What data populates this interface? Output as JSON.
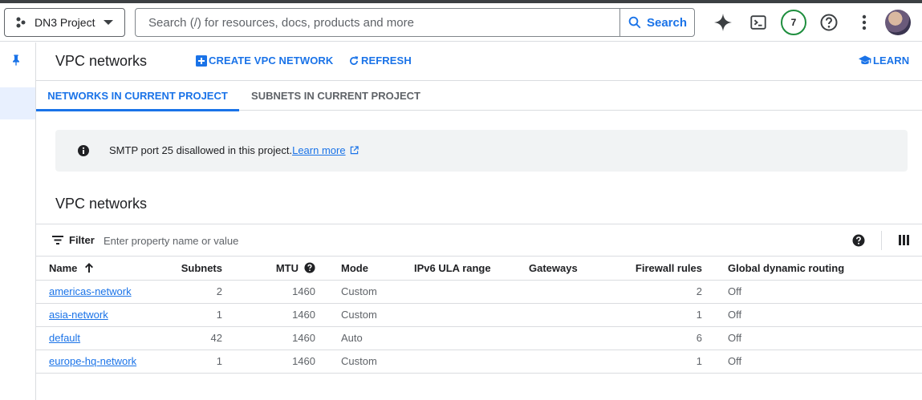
{
  "header": {
    "project": "DN3 Project",
    "search_placeholder": "Search (/) for resources, docs, products and more",
    "search_button": "Search",
    "notification_count": "7",
    "icons": [
      "gemini-sparkle-icon",
      "cloud-shell-icon",
      "help-icon",
      "more-vert-icon"
    ]
  },
  "page": {
    "title": "VPC networks",
    "create_label": "CREATE VPC NETWORK",
    "refresh_label": "REFRESH",
    "learn_label": "LEARN"
  },
  "tabs": [
    {
      "label": "NETWORKS IN CURRENT PROJECT",
      "active": true
    },
    {
      "label": "SUBNETS IN CURRENT PROJECT",
      "active": false
    }
  ],
  "banner": {
    "message": "SMTP port 25 disallowed in this project.",
    "link": "Learn more"
  },
  "section": {
    "title": "VPC networks",
    "filter_label": "Filter",
    "filter_placeholder": "Enter property name or value"
  },
  "table": {
    "columns": [
      "Name",
      "Subnets",
      "MTU",
      "Mode",
      "IPv6 ULA range",
      "Gateways",
      "Firewall rules",
      "Global dynamic routing"
    ],
    "rows": [
      {
        "name": "americas-network",
        "subnets": "2",
        "mtu": "1460",
        "mode": "Custom",
        "ipv6": "",
        "gateways": "",
        "firewall": "2",
        "gdr": "Off"
      },
      {
        "name": "asia-network",
        "subnets": "1",
        "mtu": "1460",
        "mode": "Custom",
        "ipv6": "",
        "gateways": "",
        "firewall": "1",
        "gdr": "Off"
      },
      {
        "name": "default",
        "subnets": "42",
        "mtu": "1460",
        "mode": "Auto",
        "ipv6": "",
        "gateways": "",
        "firewall": "6",
        "gdr": "Off"
      },
      {
        "name": "europe-hq-network",
        "subnets": "1",
        "mtu": "1460",
        "mode": "Custom",
        "ipv6": "",
        "gateways": "",
        "firewall": "1",
        "gdr": "Off"
      }
    ]
  },
  "colors": {
    "accent": "#1a73e8",
    "text": "#202124",
    "muted": "#5f6368",
    "border": "#dadce0",
    "banner_bg": "#f1f3f4"
  }
}
